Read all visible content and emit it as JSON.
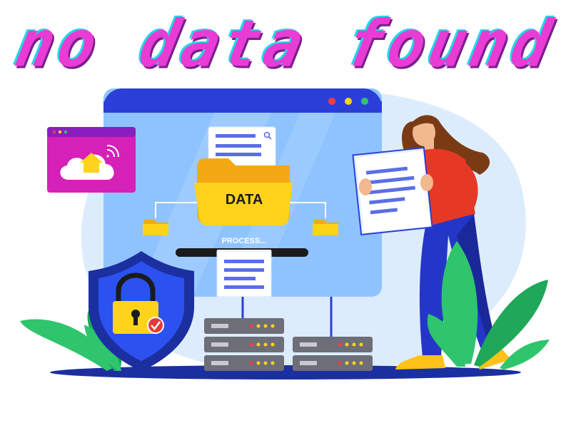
{
  "headline": "no data found",
  "folder_label": "DATA",
  "process_label": "PROCESS...",
  "colors": {
    "headline": "#e93cd5",
    "headline_shadow": "#1fd8e6",
    "browser_blue": "#2b3fd8",
    "screen_light": "#8ec3ff",
    "folder": "#ffd31a",
    "shield": "#233fd1",
    "plant": "#2ec56c",
    "magenta_card": "#d521b8"
  },
  "icons": [
    "cloud-home-icon",
    "wifi-icon",
    "search-icon",
    "lock-icon",
    "check-icon",
    "folder-icon",
    "server-rack-icon"
  ]
}
